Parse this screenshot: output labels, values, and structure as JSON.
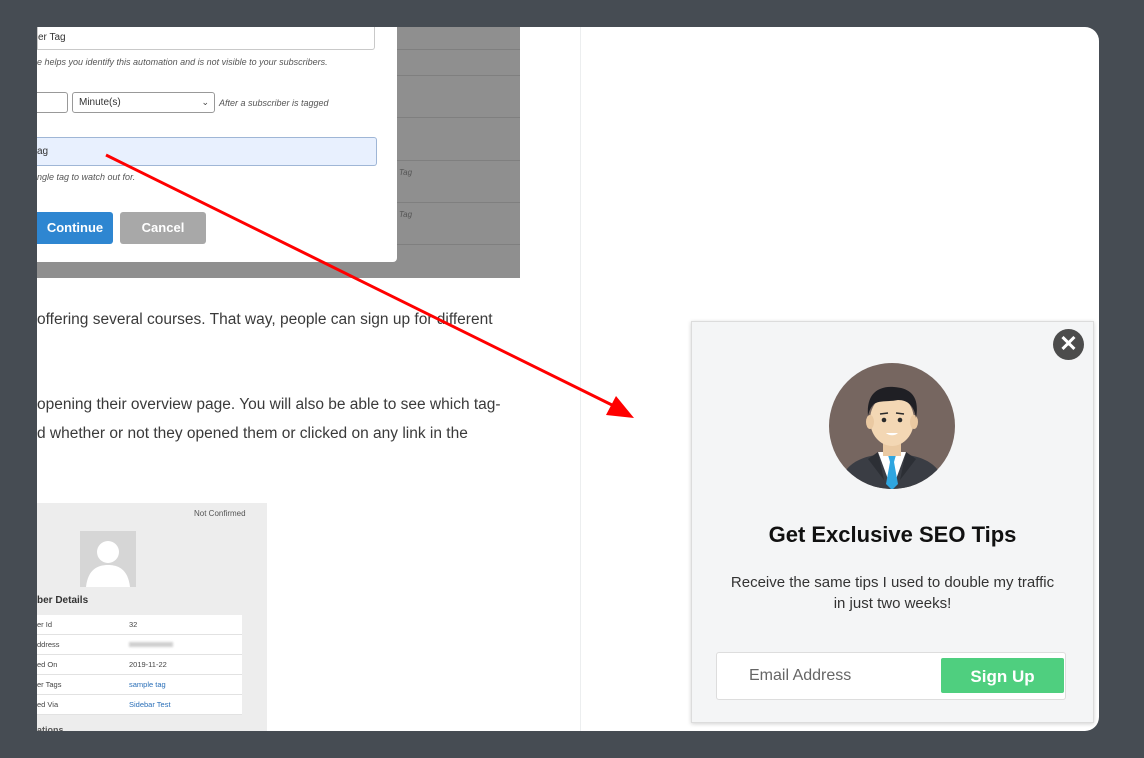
{
  "modal": {
    "name_value": "er Tag",
    "name_help": "e helps you identify this automation and is not visible to your subscribers.",
    "delay_unit": "Minute(s)",
    "delay_after": "After a subscriber is tagged",
    "tag_value": "ag",
    "tag_help": "ngle tag to watch out for.",
    "continue_label": "Continue",
    "cancel_label": "Cancel",
    "bg_tag_1": "Tag",
    "bg_tag_2": "Tag"
  },
  "article": {
    "p1_line1": "offering several courses. That way, people can sign up for different",
    "p2_line1": "opening their overview page. You will also be able to see which tag-",
    "p2_line2": "d whether or not they opened them or clicked on any link in the"
  },
  "subscriber_shot": {
    "status": "Not Confirmed",
    "section_title": "ber Details",
    "rows": [
      {
        "label": "er Id",
        "value": "32"
      },
      {
        "label": "ddress",
        "value": ""
      },
      {
        "label": "ed On",
        "value": "2019-11-22"
      },
      {
        "label": "er Tags",
        "value": "sample tag"
      },
      {
        "label": "ed Via",
        "value": "Sidebar Test"
      }
    ],
    "next_section": "ations"
  },
  "popup": {
    "title": "Get Exclusive SEO Tips",
    "description_line1": "Receive the same tips I used to double my traffic",
    "description_line2": "in just two weeks!",
    "email_placeholder": "Email Address",
    "signup_label": "Sign Up",
    "close_symbol": "✕"
  },
  "colors": {
    "background": "#464c53",
    "signup_button": "#4fcf7f",
    "continue_button": "#2e86d1",
    "arrow": "#ff0000"
  }
}
